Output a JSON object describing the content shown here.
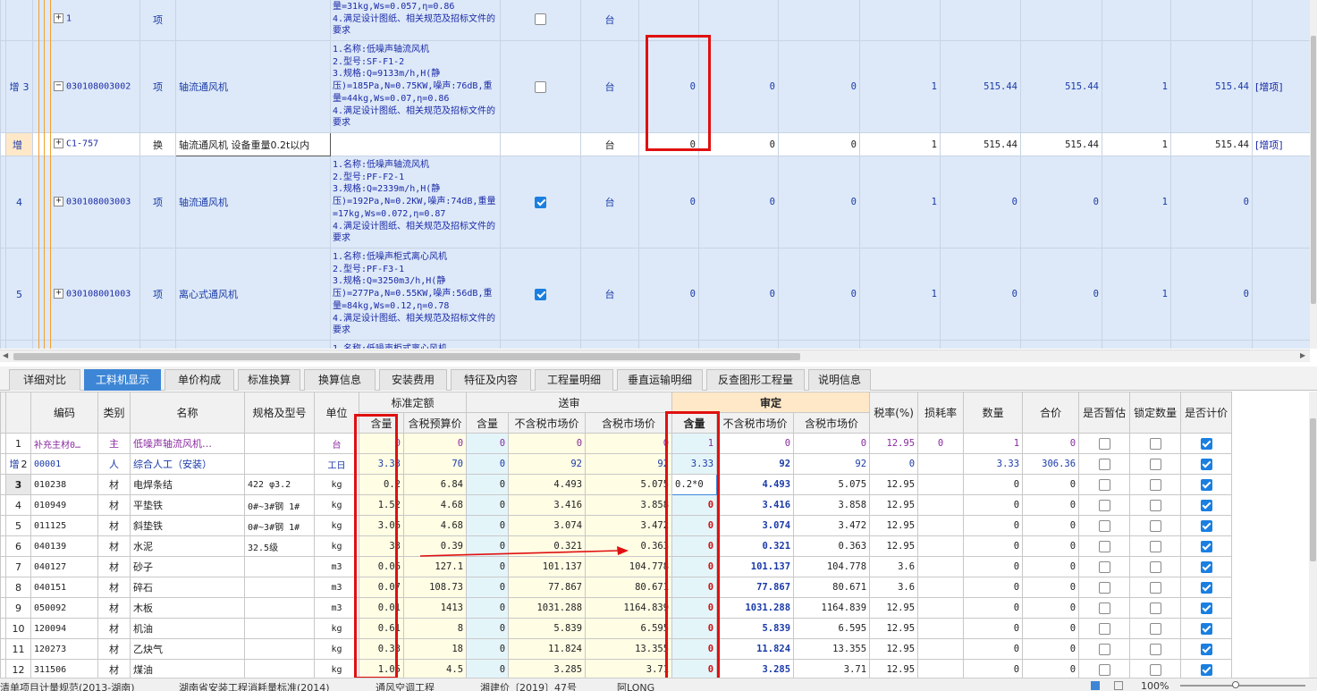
{
  "top_rows": [
    {
      "id": "r-partial",
      "style": "blue",
      "height": 48,
      "marker": "",
      "idx": "",
      "tog": "+",
      "code": "1",
      "type": "项",
      "name": "",
      "desc": "量=31kg,Ws=0.057,η=0.86\n4.满足设计图纸、相关规范及招标文件的要求",
      "checked": false,
      "unit": "台",
      "c1": "",
      "c2": "",
      "c3": "",
      "c4": "",
      "c5": "",
      "c6": "",
      "c7": "",
      "c8": "",
      "note": ""
    },
    {
      "id": "r3",
      "style": "blue",
      "height": 103,
      "marker": "增",
      "idx": "3",
      "tog": "−",
      "code": "030108003002",
      "type": "项",
      "name": "轴流通风机",
      "desc": "1.名称:低噪声轴流风机\n2.型号:SF-F1-2\n3.规格:Q=9133m/h,H(静压)=185Pa,N=0.75KW,噪声:76dB,重量=44kg,Ws=0.07,η=0.86\n4.满足设计图纸、相关规范及招标文件的要求",
      "checked": false,
      "unit": "台",
      "c1": "0",
      "c2": "0",
      "c3": "0",
      "c4": "1",
      "c5": "515.44",
      "c6": "515.44",
      "c7": "1",
      "c8": "515.44",
      "note": "[增项]"
    },
    {
      "id": "r3s",
      "style": "white",
      "height": 26,
      "marker": "增",
      "idx": "",
      "tog": "+",
      "code": "C1-757",
      "type": "换",
      "name": "轴流通风机 设备重量0.2t以内",
      "desc": "",
      "checked": null,
      "unit": "台",
      "c1": "0",
      "c2": "0",
      "c3": "0",
      "c4": "1",
      "c5": "515.44",
      "c6": "515.44",
      "c7": "1",
      "c8": "515.44",
      "note": "[增项]"
    },
    {
      "id": "r4",
      "style": "blue",
      "height": 103,
      "marker": "",
      "idx": "4",
      "tog": "+",
      "code": "030108003003",
      "type": "项",
      "name": "轴流通风机",
      "desc": "1.名称:低噪声轴流风机\n2.型号:PF-F2-1\n3.规格:Q=2339m/h,H(静压)=192Pa,N=0.2KW,噪声:74dB,重量=17kg,Ws=0.072,η=0.87\n4.满足设计图纸、相关规范及招标文件的要求",
      "checked": true,
      "unit": "台",
      "c1": "0",
      "c2": "0",
      "c3": "0",
      "c4": "1",
      "c5": "0",
      "c6": "0",
      "c7": "1",
      "c8": "0",
      "note": ""
    },
    {
      "id": "r5",
      "style": "blue",
      "height": 103,
      "marker": "",
      "idx": "5",
      "tog": "+",
      "code": "030108001003",
      "type": "项",
      "name": "离心式通风机",
      "desc": "1.名称:低噪声柜式离心风机\n2.型号:PF-F3-1\n3.规格:Q=3250m3/h,H(静压)=277Pa,N=0.55KW,噪声:56dB,重量=84kg,Ws=0.12,η=0.78\n4.满足设计图纸、相关规范及招标文件的要求",
      "checked": true,
      "unit": "台",
      "c1": "0",
      "c2": "0",
      "c3": "0",
      "c4": "1",
      "c5": "0",
      "c6": "0",
      "c7": "1",
      "c8": "0",
      "note": ""
    },
    {
      "id": "r6",
      "style": "blue",
      "height": 20,
      "marker": "",
      "idx": "",
      "tog": "",
      "code": "",
      "type": "",
      "name": "",
      "desc": "1.名称:低噪声柜式离心风机",
      "checked": null,
      "unit": "",
      "c1": "",
      "c2": "",
      "c3": "",
      "c4": "",
      "c5": "",
      "c6": "",
      "c7": "",
      "c8": "",
      "note": ""
    }
  ],
  "tabs": [
    "详细对比",
    "工料机显示",
    "单价构成",
    "标准换算",
    "换算信息",
    "安装费用",
    "特征及内容",
    "工程量明细",
    "垂直运输明细",
    "反查图形工程量",
    "说明信息"
  ],
  "active_tab": "工料机显示",
  "header": {
    "code": "编码",
    "type": "类别",
    "name": "名称",
    "spec": "规格及型号",
    "unit": "单位",
    "group_std": "标准定额",
    "group_send": "送审",
    "group_audit": "审定",
    "qty": "含量",
    "tax_budget": "含税预算价",
    "notax_market": "不含税市场价",
    "tax_market": "含税市场价",
    "taxrate": "税率(%)",
    "loss": "损耗率",
    "amount": "数量",
    "total": "合价",
    "est": "是否暂估",
    "lockq": "锁定数量",
    "priced": "是否计价"
  },
  "materials": [
    {
      "idx": "1",
      "marker": "",
      "code": "补充主材0…",
      "type": "主",
      "name": "低噪声轴流风机…",
      "spec": "",
      "unit": "台",
      "q1": "0",
      "p1": "0",
      "q2": "0",
      "nt2": "0",
      "t2": "0",
      "q3": "1",
      "nt3": "0",
      "t3": "0",
      "tax": "12.95",
      "loss": "0",
      "amt": "1",
      "total": "0",
      "est": false,
      "lock": false,
      "priced": true,
      "style": "pur"
    },
    {
      "idx": "2",
      "marker": "增",
      "code": "00001",
      "type": "人",
      "name": "综合人工（安装）",
      "spec": "",
      "unit": "工日",
      "q1": "3.33",
      "p1": "70",
      "q2": "0",
      "nt2": "92",
      "t2": "92",
      "q3": "3.33",
      "nt3": "92",
      "t3": "92",
      "tax": "0",
      "loss": "",
      "amt": "3.33",
      "total": "306.36",
      "est": false,
      "lock": false,
      "priced": true,
      "style": "blue"
    },
    {
      "idx": "3",
      "marker": "",
      "code": "010238",
      "type": "材",
      "name": "电焊条结",
      "spec": "422 φ3.2",
      "unit": "kg",
      "q1": "0.2",
      "p1": "6.84",
      "q2": "0",
      "nt2": "4.493",
      "t2": "5.075",
      "q3": "0.2*0",
      "nt3": "4.493",
      "t3": "5.075",
      "tax": "12.95",
      "loss": "",
      "amt": "0",
      "total": "0",
      "est": false,
      "lock": false,
      "priced": true,
      "style": "edit"
    },
    {
      "idx": "4",
      "marker": "",
      "code": "010949",
      "type": "材",
      "name": "平垫铁",
      "spec": "0#~3#钢 1#",
      "unit": "kg",
      "q1": "1.52",
      "p1": "4.68",
      "q2": "0",
      "nt2": "3.416",
      "t2": "3.858",
      "q3": "0",
      "nt3": "3.416",
      "t3": "3.858",
      "tax": "12.95",
      "loss": "",
      "amt": "0",
      "total": "0",
      "est": false,
      "lock": false,
      "priced": true,
      "style": ""
    },
    {
      "idx": "5",
      "marker": "",
      "code": "011125",
      "type": "材",
      "name": "斜垫铁",
      "spec": "0#~3#钢 1#",
      "unit": "kg",
      "q1": "3.06",
      "p1": "4.68",
      "q2": "0",
      "nt2": "3.074",
      "t2": "3.472",
      "q3": "0",
      "nt3": "3.074",
      "t3": "3.472",
      "tax": "12.95",
      "loss": "",
      "amt": "0",
      "total": "0",
      "est": false,
      "lock": false,
      "priced": true,
      "style": ""
    },
    {
      "idx": "6",
      "marker": "",
      "code": "040139",
      "type": "材",
      "name": "水泥",
      "spec": "32.5级",
      "unit": "kg",
      "q1": "33",
      "p1": "0.39",
      "q2": "0",
      "nt2": "0.321",
      "t2": "0.363",
      "q3": "0",
      "nt3": "0.321",
      "t3": "0.363",
      "tax": "12.95",
      "loss": "",
      "amt": "0",
      "total": "0",
      "est": false,
      "lock": false,
      "priced": true,
      "style": ""
    },
    {
      "idx": "7",
      "marker": "",
      "code": "040127",
      "type": "材",
      "name": "砂子",
      "spec": "",
      "unit": "m3",
      "q1": "0.06",
      "p1": "127.1",
      "q2": "0",
      "nt2": "101.137",
      "t2": "104.778",
      "q3": "0",
      "nt3": "101.137",
      "t3": "104.778",
      "tax": "3.6",
      "loss": "",
      "amt": "0",
      "total": "0",
      "est": false,
      "lock": false,
      "priced": true,
      "style": ""
    },
    {
      "idx": "8",
      "marker": "",
      "code": "040151",
      "type": "材",
      "name": "碎石",
      "spec": "",
      "unit": "m3",
      "q1": "0.07",
      "p1": "108.73",
      "q2": "0",
      "nt2": "77.867",
      "t2": "80.671",
      "q3": "0",
      "nt3": "77.867",
      "t3": "80.671",
      "tax": "3.6",
      "loss": "",
      "amt": "0",
      "total": "0",
      "est": false,
      "lock": false,
      "priced": true,
      "style": ""
    },
    {
      "idx": "9",
      "marker": "",
      "code": "050092",
      "type": "材",
      "name": "木板",
      "spec": "",
      "unit": "m3",
      "q1": "0.01",
      "p1": "1413",
      "q2": "0",
      "nt2": "1031.288",
      "t2": "1164.839",
      "q3": "0",
      "nt3": "1031.288",
      "t3": "1164.839",
      "tax": "12.95",
      "loss": "",
      "amt": "0",
      "total": "0",
      "est": false,
      "lock": false,
      "priced": true,
      "style": ""
    },
    {
      "idx": "10",
      "marker": "",
      "code": "120094",
      "type": "材",
      "name": "机油",
      "spec": "",
      "unit": "kg",
      "q1": "0.61",
      "p1": "8",
      "q2": "0",
      "nt2": "5.839",
      "t2": "6.595",
      "q3": "0",
      "nt3": "5.839",
      "t3": "6.595",
      "tax": "12.95",
      "loss": "",
      "amt": "0",
      "total": "0",
      "est": false,
      "lock": false,
      "priced": true,
      "style": ""
    },
    {
      "idx": "11",
      "marker": "",
      "code": "120273",
      "type": "材",
      "name": "乙炔气",
      "spec": "",
      "unit": "kg",
      "q1": "0.33",
      "p1": "18",
      "q2": "0",
      "nt2": "11.824",
      "t2": "13.355",
      "q3": "0",
      "nt3": "11.824",
      "t3": "13.355",
      "tax": "12.95",
      "loss": "",
      "amt": "0",
      "total": "0",
      "est": false,
      "lock": false,
      "priced": true,
      "style": ""
    },
    {
      "idx": "12",
      "marker": "",
      "code": "311506",
      "type": "材",
      "name": "煤油",
      "spec": "",
      "unit": "kg",
      "q1": "1.05",
      "p1": "4.5",
      "q2": "0",
      "nt2": "3.285",
      "t2": "3.71",
      "q3": "0",
      "nt3": "3.285",
      "t3": "3.71",
      "tax": "12.95",
      "loss": "",
      "amt": "0",
      "total": "0",
      "est": false,
      "lock": false,
      "priced": true,
      "style": ""
    }
  ],
  "status": {
    "s1": "清单项目计量规范(2013-湖南)",
    "s2": "湖南省安装工程消耗量标准(2014)",
    "s3": "通风空调工程",
    "s4": "湘建价〔2019〕47号",
    "s5": "阿LONG",
    "zoom": "100%"
  }
}
